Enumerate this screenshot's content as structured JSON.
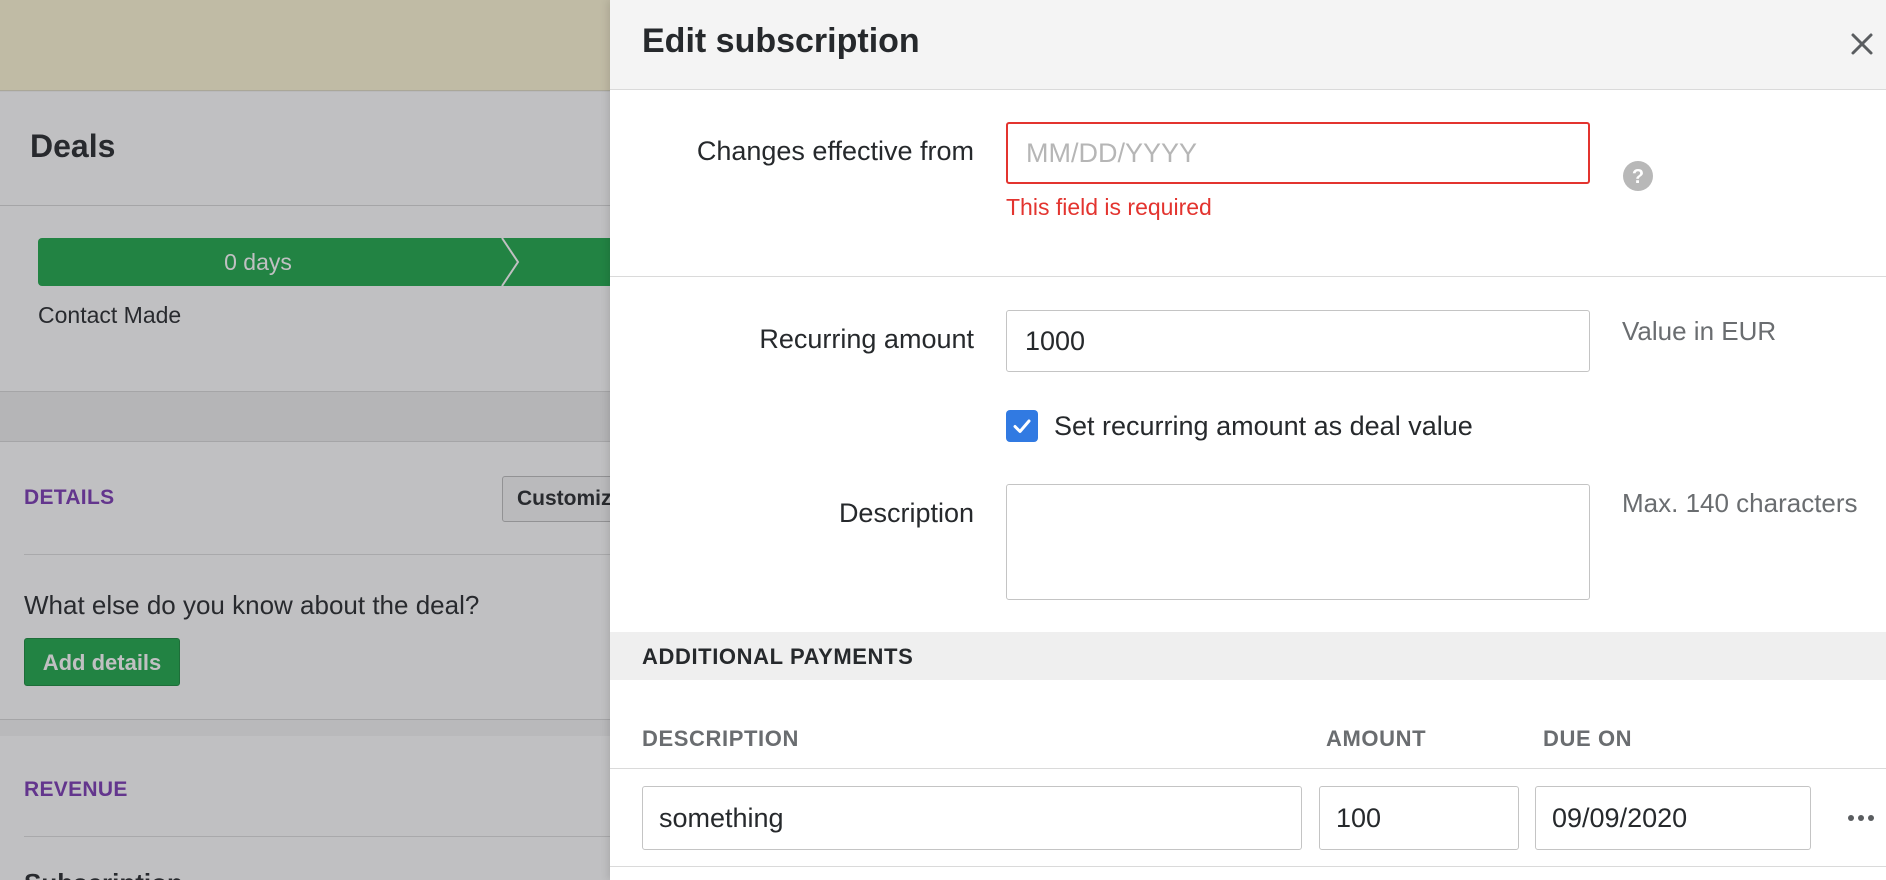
{
  "background": {
    "page_title": "Deals",
    "pipeline": {
      "stage_duration": "0 days",
      "stage_name": "Contact Made",
      "stage_color": "#1ea84a"
    },
    "details": {
      "section_title": "DETAILS",
      "customize_label": "Customize",
      "question": "What else do you know about the deal?",
      "add_details_label": "Add details"
    },
    "revenue": {
      "section_title": "REVENUE",
      "subscription_label": "Subscription"
    }
  },
  "modal": {
    "title": "Edit subscription",
    "close_icon": "close-icon",
    "effective_from": {
      "label": "Changes effective from",
      "value": "",
      "placeholder": "MM/DD/YYYY",
      "error": "This field is required",
      "help_icon": "question-circle-icon"
    },
    "recurring_amount": {
      "label": "Recurring amount",
      "value": "1000",
      "note": "Value in EUR"
    },
    "set_as_deal_value": {
      "label": "Set recurring amount as deal value",
      "checked": true
    },
    "description": {
      "label": "Description",
      "value": "",
      "note": "Max. 140 characters"
    },
    "additional_payments": {
      "title": "ADDITIONAL PAYMENTS",
      "columns": [
        "DESCRIPTION",
        "AMOUNT",
        "DUE ON"
      ],
      "rows": [
        {
          "description": "something",
          "amount": "100",
          "due_on": "09/09/2020"
        }
      ],
      "row_menu_icon": "more-horizontal-icon"
    }
  },
  "colors": {
    "accent_green": "#1ea84a",
    "error_red": "#e3342f",
    "checkbox_blue": "#317ae2",
    "section_purple": "#7a38b4"
  }
}
